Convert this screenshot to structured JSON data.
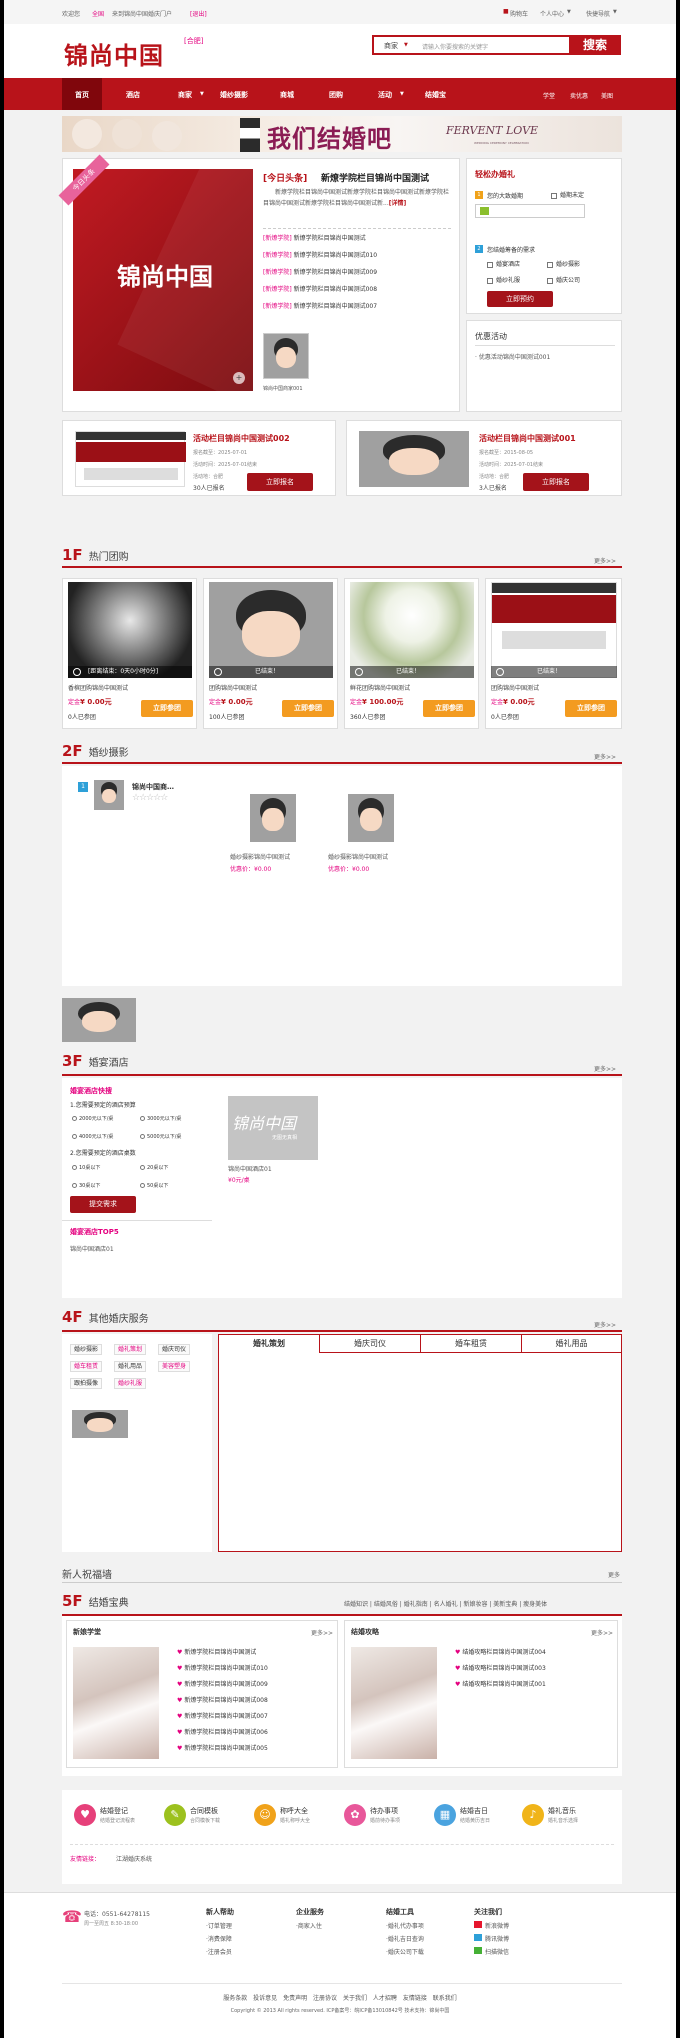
{
  "topbar": {
    "welcome": "欢迎您",
    "city": "全国",
    "site_link": "来到锦尚中国婚庆门户",
    "logout": "[退出]",
    "cart": "购物车",
    "user_center": "个人中心",
    "quick_nav": "快捷导航"
  },
  "header": {
    "logo": "锦尚中国",
    "city_badge": "[合肥]",
    "search_scope": "商家",
    "search_placeholder": "请输入你要搜索的关键字",
    "search_button": "搜索"
  },
  "nav": {
    "items": [
      "首页",
      "酒店",
      "商家",
      "婚纱摄影",
      "商城",
      "团购",
      "活动",
      "结婚宝"
    ],
    "right": [
      "学堂",
      "卖优惠",
      "美图"
    ]
  },
  "banner": {
    "text": "我们结婚吧",
    "script_text": "FERVENT LOVE",
    "sub": "WEDDING CEREMONY CELEBRATION"
  },
  "feature": {
    "ribbon": "今日头条",
    "logo": "锦尚中国",
    "headline_tag": "[今日头条]",
    "headline": "新燎学院栏目锦尚中国测试",
    "summary": "新燎学院栏目锦尚中国测试新燎学院栏目锦尚中国测试新燎学院栏目锦尚中国测试新燎学院栏目锦尚中国测试新...",
    "detail": "[详情]",
    "list": [
      {
        "tag": "[新燎学院]",
        "text": "新燎学院栏目锦尚中国测试"
      },
      {
        "tag": "[新燎学院]",
        "text": "新燎学院栏目锦尚中国测试010"
      },
      {
        "tag": "[新燎学院]",
        "text": "新燎学院栏目锦尚中国测试009"
      },
      {
        "tag": "[新燎学院]",
        "text": "新燎学院栏目锦尚中国测试008"
      },
      {
        "tag": "[新燎学院]",
        "text": "新燎学院栏目锦尚中国测试007"
      }
    ],
    "avatar_caption": "锦尚中国商家001"
  },
  "planner": {
    "title": "轻松办婚礼",
    "step1": "您的大致婚期",
    "undecided": "婚期未定",
    "step2": "您结婚筹备的需求",
    "needs": [
      "婚宴酒店",
      "婚纱摄影",
      "婚纱礼服",
      "婚庆公司"
    ],
    "button": "立即预约",
    "promo_title": "优惠活动",
    "promo_item": "优惠活动锦尚中国测试001"
  },
  "activities": [
    {
      "title": "活动栏目锦尚中国测试002",
      "deadline": "报名截至：2025-07-01",
      "time": "活动时间：2025-07-01结束",
      "place": "活动地：合肥",
      "count": "30人已报名",
      "button": "立即报名"
    },
    {
      "title": "活动栏目锦尚中国测试001",
      "deadline": "报名截至：2015-08-05",
      "time": "活动时间：2025-07-01结束",
      "place": "活动地：合肥",
      "count": "3人已报名",
      "button": "立即报名"
    }
  ],
  "floor1": {
    "num": "1F",
    "name": "热门团购",
    "more": "更多>>",
    "items": [
      {
        "status": "[距离结束：0天0小时0分]",
        "title": "香槟团购锦尚中国测试",
        "price": "¥ 0.00元",
        "joined": "0人已参团",
        "button": "立即参团"
      },
      {
        "status": "已结束！",
        "title": "团购锦尚中国测试",
        "price": "¥ 0.00元",
        "joined": "100人已参团",
        "button": "立即参团"
      },
      {
        "status": "已结束！",
        "title": "鲜花团购锦尚中国测试",
        "price": "¥ 100.00元",
        "joined": "360人已参团",
        "button": "立即参团"
      },
      {
        "status": "已结束！",
        "title": "团购锦尚中国测试",
        "price": "¥ 0.00元",
        "joined": "0人已参团",
        "button": "立即参团"
      }
    ],
    "price_label": "定金"
  },
  "floor2": {
    "num": "2F",
    "name": "婚纱摄影",
    "more": "更多>>",
    "rank": "1",
    "shop": "锦尚中国商…",
    "stars": "☆☆☆☆☆",
    "items": [
      {
        "title": "婚纱摄影锦尚中国测试",
        "price": "优惠价：¥0.00"
      },
      {
        "title": "婚纱摄影锦尚中国测试",
        "price": "优惠价：¥0.00"
      }
    ]
  },
  "floor3": {
    "num": "3F",
    "name": "婚宴酒店",
    "more": "更多>>",
    "quick_title": "婚宴酒店快搜",
    "q1": "1.您需要预定的酒店预算",
    "budgets": [
      "2000元以下/桌",
      "3000元以下/桌",
      "4000元以下/桌",
      "5000元以下/桌"
    ],
    "q2": "2.您需要预定的酒店桌数",
    "tables": [
      "10桌以下",
      "20桌以下",
      "30桌以下",
      "50桌以下"
    ],
    "submit": "提交需求",
    "top5": "婚宴酒店TOP5",
    "top_item": "锦尚中国酒店01",
    "hotel_logo": "锦尚中国",
    "hotel_logo_sub": "无图无真相",
    "hotel_name": "锦尚中国酒店01",
    "hotel_price": "¥0元/桌"
  },
  "floor4": {
    "num": "4F",
    "name": "其他婚庆服务",
    "more": "更多>>",
    "tags": [
      "婚纱摄影",
      "婚礼策划",
      "婚庆司仪",
      "婚车租赁",
      "婚礼用品",
      "美容塑身",
      "跟拍摄像",
      "婚纱礼服"
    ],
    "tabs": [
      "婚礼策划",
      "婚庆司仪",
      "婚车租赁",
      "婚礼用品"
    ]
  },
  "blessing": {
    "title": "新人祝福墙",
    "more": "更多"
  },
  "floor5": {
    "num": "5F",
    "name": "结婚宝典",
    "links": [
      "结婚知识",
      "结婚风俗",
      "婚礼指南",
      "名人婚礼",
      "新娘妆容",
      "美新宝典",
      "瘦身美体"
    ],
    "left_title": "新娘学堂",
    "left_more": "更多>>",
    "left_items": [
      "新燎学院栏目锦尚中国测试",
      "新燎学院栏目锦尚中国测试010",
      "新燎学院栏目锦尚中国测试009",
      "新燎学院栏目锦尚中国测试008",
      "新燎学院栏目锦尚中国测试007",
      "新燎学院栏目锦尚中国测试006",
      "新燎学院栏目锦尚中国测试005"
    ],
    "right_title": "结婚攻略",
    "right_more": "更多>>",
    "right_items": [
      "结婚攻略栏目锦尚中国测试004",
      "结婚攻略栏目锦尚中国测试003",
      "结婚攻略栏目锦尚中国测试001"
    ]
  },
  "tools": [
    {
      "name": "结婚登记",
      "sub": "结婚登记流程表",
      "color": "#e6407a",
      "icon": "♥"
    },
    {
      "name": "合同模板",
      "sub": "合同模板下载",
      "color": "#9cc11e",
      "icon": "✎"
    },
    {
      "name": "称呼大全",
      "sub": "婚礼称呼大全",
      "color": "#f0a21a",
      "icon": "☺"
    },
    {
      "name": "待办事项",
      "sub": "婚前待办事项",
      "color": "#e8579a",
      "icon": "✿"
    },
    {
      "name": "结婚吉日",
      "sub": "结婚黄历吉日",
      "color": "#4aa3df",
      "icon": "▦"
    },
    {
      "name": "婚礼音乐",
      "sub": "婚礼音乐选择",
      "color": "#f0b419",
      "icon": "♪"
    }
  ],
  "friend_links": {
    "label": "友情链接：",
    "item": "江湖婚庆系统"
  },
  "footer": {
    "phone_label": "电话：",
    "phone": "0551-64278115",
    "hours": "周一至周五 8:30-18:00",
    "cols": [
      {
        "title": "新人帮助",
        "items": [
          "·订单管理",
          "·消费保障",
          "·注册会员"
        ]
      },
      {
        "title": "企业服务",
        "items": [
          "·商家入住"
        ]
      },
      {
        "title": "结婚工具",
        "items": [
          "·婚礼代办事项",
          "·婚礼吉日查询",
          "·婚庆公司下载"
        ]
      },
      {
        "title": "关注我们",
        "items": [
          "新浪微博",
          "腾讯微博",
          "扫描微信"
        ]
      }
    ],
    "links": [
      "服务条款",
      "投诉意见",
      "免责声明",
      "注册协议",
      "关于我们",
      "人才招聘",
      "友情链接",
      "联系我们"
    ],
    "copyright": "Copyright © 2013 All rights reserved. ICP备案号：皖ICP备13010842号  技术支持：锦尚中国"
  }
}
